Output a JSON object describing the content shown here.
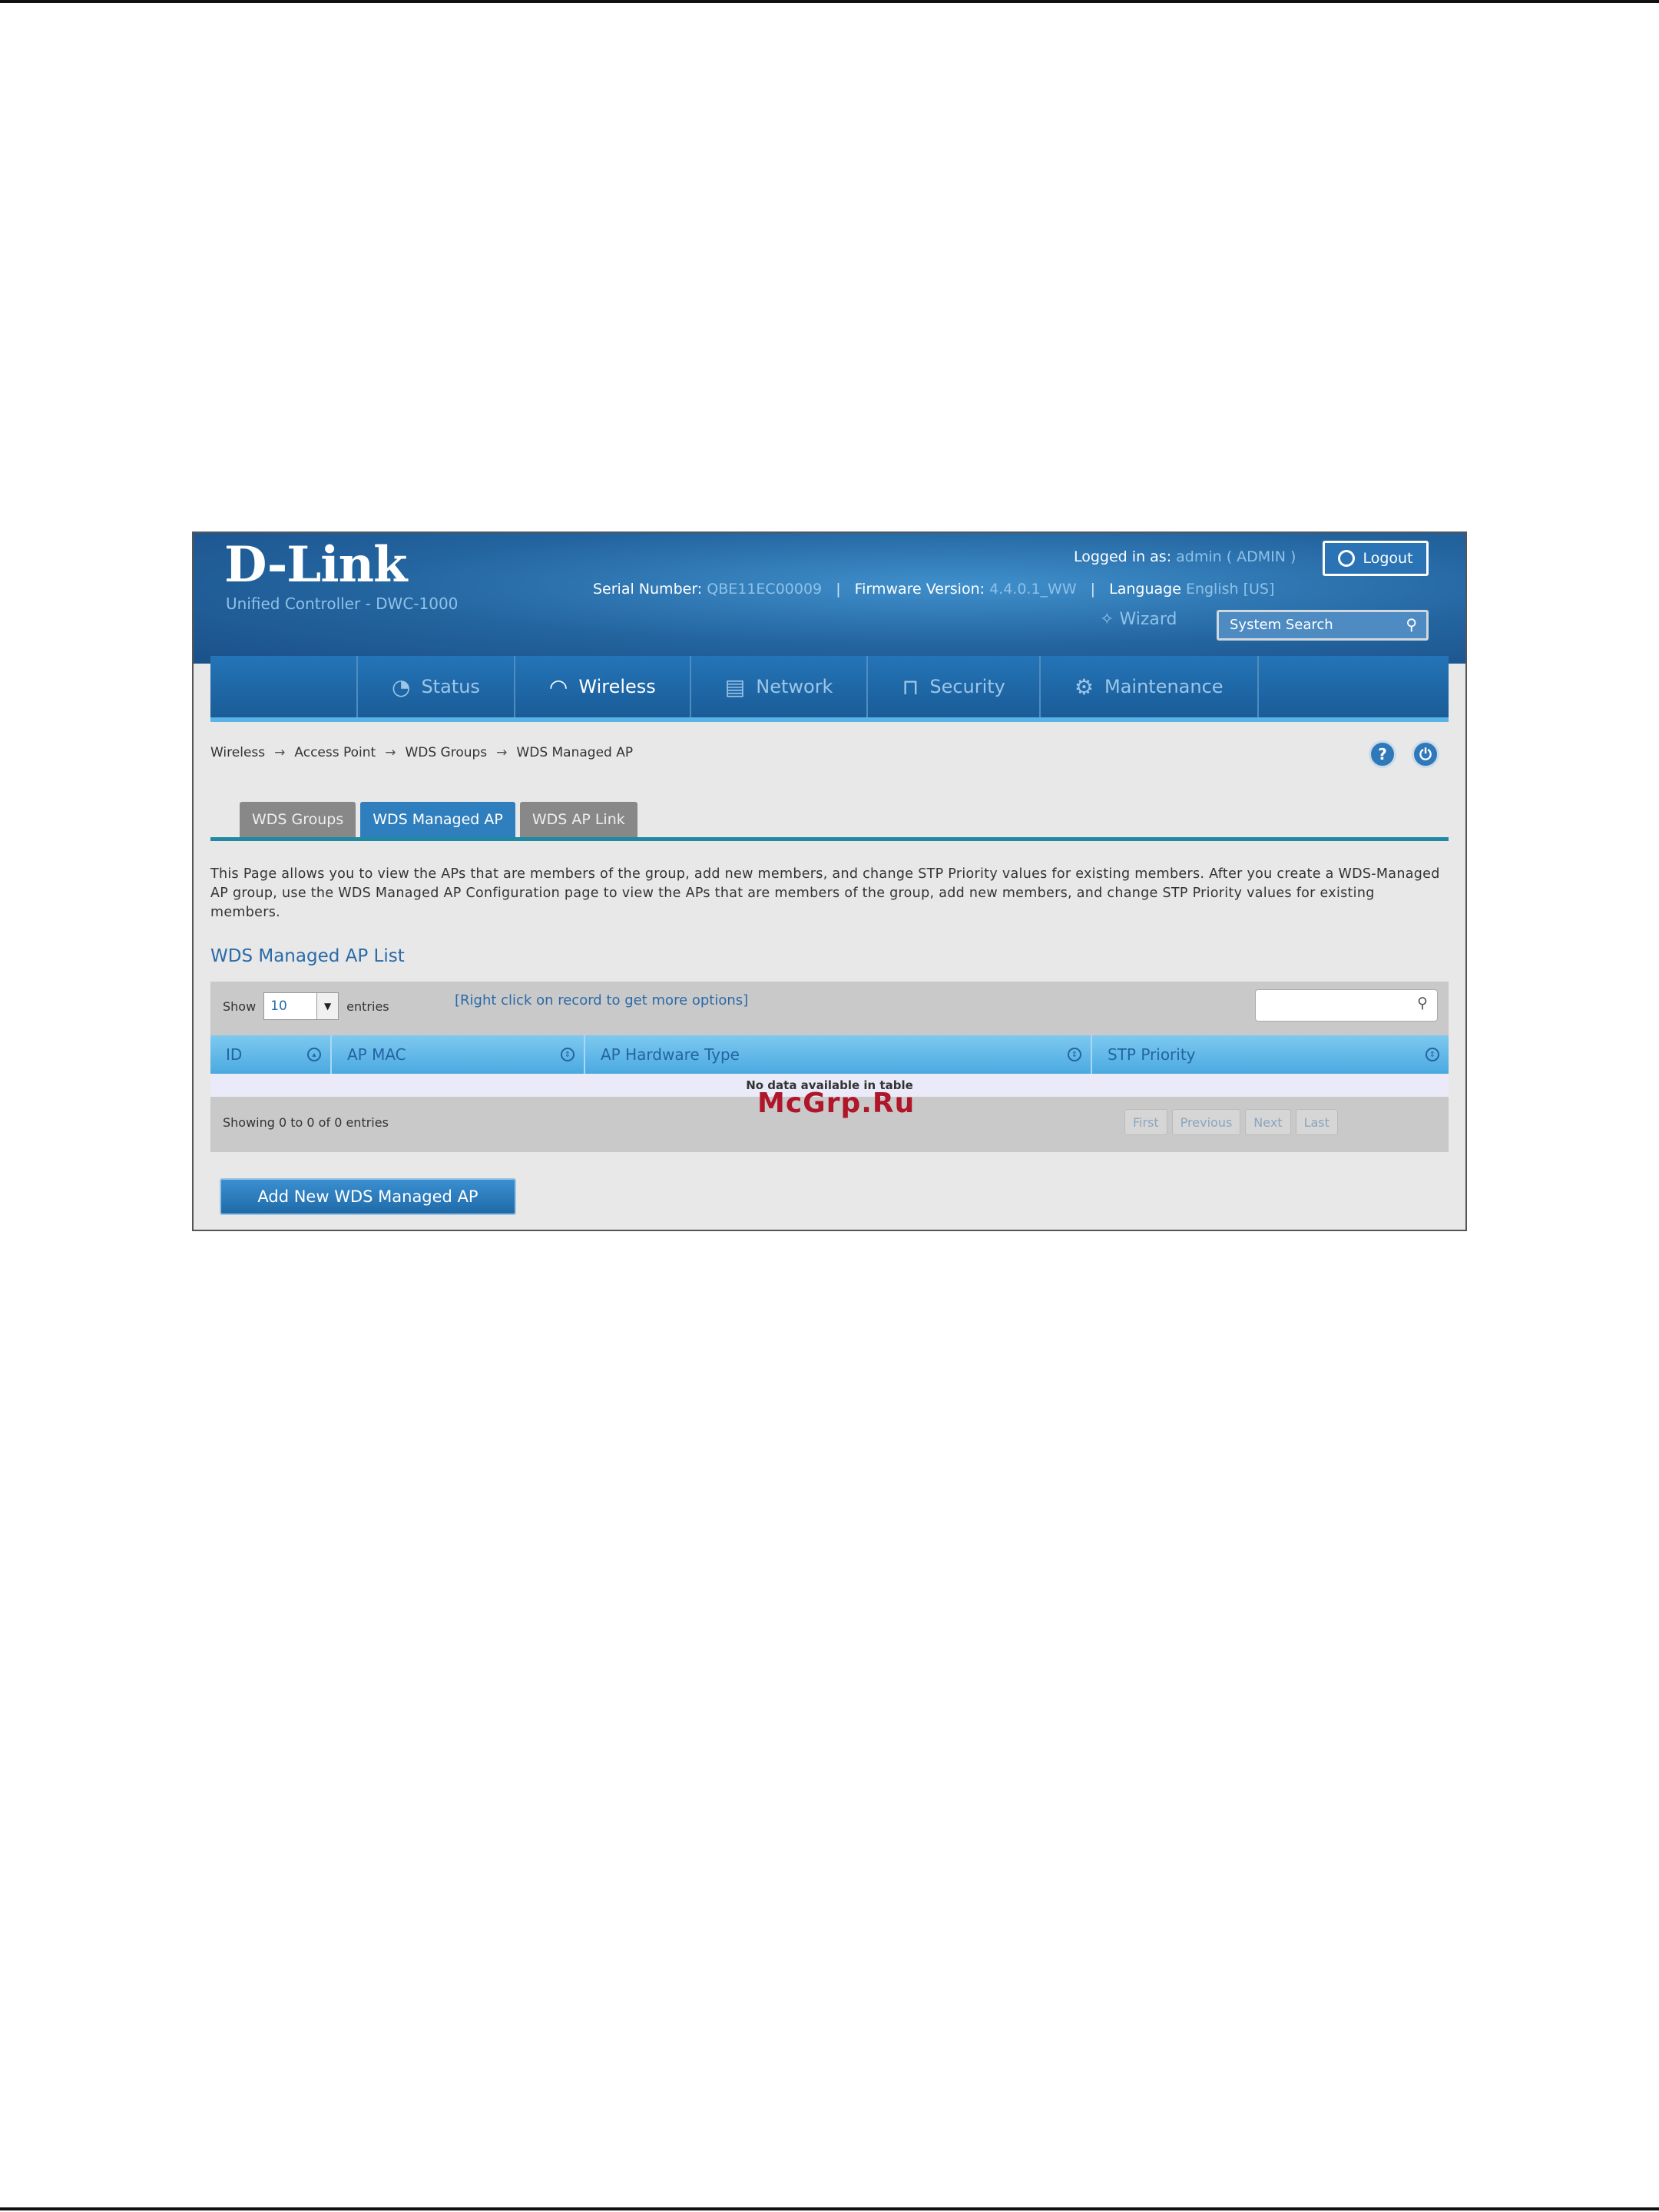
{
  "header": {
    "logo": "D-Link",
    "subtitle": "Unified Controller - DWC-1000",
    "serial_label": "Serial Number:",
    "serial_value": "QBE11EC00009",
    "firmware_label": "Firmware Version:",
    "firmware_value": "4.4.0.1_WW",
    "language_label": "Language",
    "language_value": "English [US]",
    "logged_in_label": "Logged in as:",
    "logged_in_user": "admin ( ADMIN )",
    "logout_label": "Logout",
    "wizard_label": "Wizard",
    "system_search_placeholder": "System Search"
  },
  "nav": {
    "items": [
      {
        "label": "Status",
        "icon": "gauge-icon"
      },
      {
        "label": "Wireless",
        "icon": "wifi-icon",
        "active": true
      },
      {
        "label": "Network",
        "icon": "server-icon"
      },
      {
        "label": "Security",
        "icon": "lock-icon"
      },
      {
        "label": "Maintenance",
        "icon": "gear-icon"
      }
    ]
  },
  "breadcrumb": [
    "Wireless",
    "Access Point",
    "WDS Groups",
    "WDS Managed AP"
  ],
  "tabs": [
    {
      "label": "WDS Groups"
    },
    {
      "label": "WDS Managed AP",
      "active": true
    },
    {
      "label": "WDS AP Link"
    }
  ],
  "description": "This Page allows you to view the APs that are members of the group, add new members, and change STP Priority values for existing members. After you create a WDS-Managed AP group, use the WDS Managed AP Configuration page to view the APs that are members of the group, add new members, and change STP Priority values for existing members.",
  "list": {
    "title": "WDS Managed AP List",
    "show_label": "Show",
    "show_value": "10",
    "entries_label": "entries",
    "hint": "[Right click on record to get more options]",
    "columns": [
      "ID",
      "AP MAC",
      "AP Hardware Type",
      "STP Priority"
    ],
    "empty_text": "No data available in table",
    "showing_text": "Showing 0 to 0 of 0 entries",
    "pager": [
      "First",
      "Previous",
      "Next",
      "Last"
    ]
  },
  "add_button_label": "Add New WDS Managed AP",
  "watermark": "McGrp.Ru",
  "colors": {
    "header_blue": "#23649f",
    "accent": "#2f7fbe",
    "tab_line": "#1f8aa2"
  }
}
